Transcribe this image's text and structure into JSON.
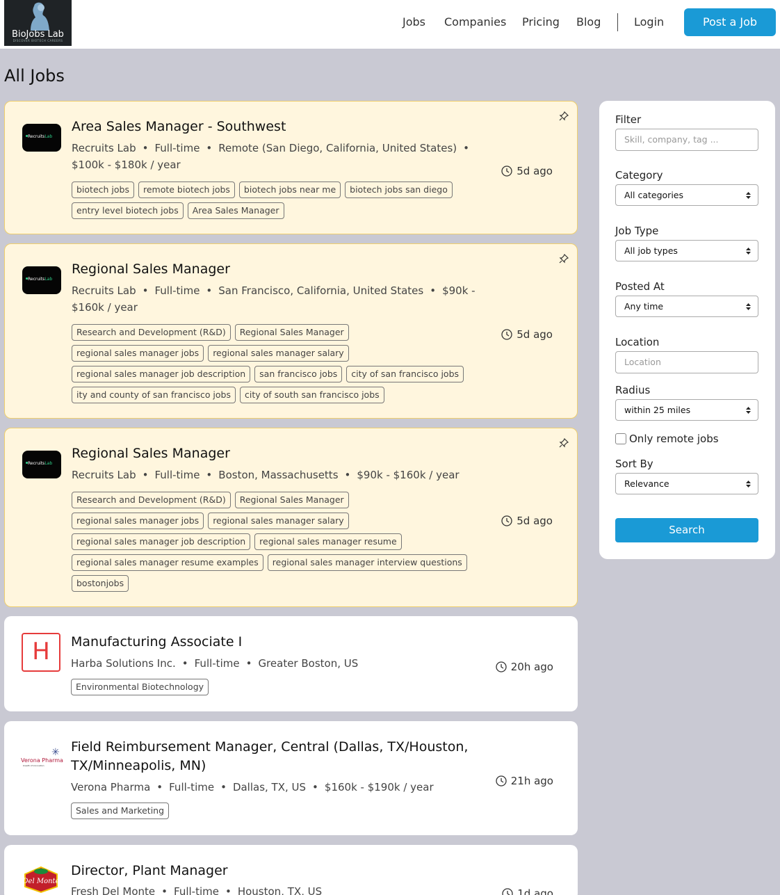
{
  "brand": {
    "name": "BioJobs Lab",
    "tagline": "DISCOVER BIOTECH CAREERS"
  },
  "nav": {
    "jobs": "Jobs",
    "companies": "Companies",
    "pricing": "Pricing",
    "blog": "Blog",
    "login": "Login",
    "post_job": "Post a Job"
  },
  "page_title": "All Jobs",
  "icons": {
    "pin": "pin-icon",
    "clock": "clock-icon",
    "caret": "select-caret-icon"
  },
  "colors": {
    "accent": "#1a9ad6",
    "featured_bg": "#fff6de",
    "featured_border": "#f0cf6c",
    "page_bg": "#c9c9d3"
  },
  "jobs": [
    {
      "title": "Area Sales Manager - Southwest",
      "company": "Recruits Lab",
      "meta_line1": [
        "Recruits Lab",
        "Full-time",
        "Remote (San Diego, California, United States)"
      ],
      "meta_line2": "$100k - $180k / year",
      "tags": [
        "biotech jobs",
        "remote biotech jobs",
        "biotech jobs near me",
        "biotech jobs san diego",
        "entry level biotech jobs",
        "Area Sales Manager"
      ],
      "posted": "5d ago",
      "featured": true
    },
    {
      "title": "Regional Sales Manager",
      "company": "Recruits Lab",
      "meta_line1": [
        "Recruits Lab",
        "Full-time",
        "San Francisco, California, United States",
        "$90k -"
      ],
      "meta_line2": "$160k / year",
      "tags": [
        "Research and Development (R&D)",
        "Regional Sales Manager",
        "regional sales manager jobs",
        "regional sales manager salary",
        "regional sales manager job description",
        "san francisco jobs",
        "city of san francisco jobs",
        "ity and county of san francisco jobs",
        "city of south san francisco jobs"
      ],
      "posted": "5d ago",
      "featured": true
    },
    {
      "title": "Regional Sales Manager",
      "company": "Recruits Lab",
      "meta_line1": [
        "Recruits Lab",
        "Full-time",
        "Boston, Massachusetts",
        "$90k - $160k / year"
      ],
      "meta_line2": "",
      "tags": [
        "Research and Development (R&D)",
        "Regional Sales Manager",
        "regional sales manager jobs",
        "regional sales manager salary",
        "regional sales manager job description",
        "regional sales manager resume",
        "regional sales manager resume examples",
        "regional sales manager interview questions",
        "bostonjobs"
      ],
      "posted": "5d ago",
      "featured": true
    },
    {
      "title": "Manufacturing Associate I",
      "company": "Harba Solutions Inc.",
      "logo_letter": "H",
      "meta_line1": [
        "Harba Solutions Inc.",
        "Full-time",
        "Greater Boston, US"
      ],
      "meta_line2": "",
      "tags": [
        "Environmental Biotechnology"
      ],
      "posted": "20h ago",
      "featured": false
    },
    {
      "title_line1": "Field Reimbursement Manager, Central (Dallas, TX/Houston,",
      "title_line2": "TX/Minneapolis, MN)",
      "company": "Verona Pharma",
      "logo_text": "Verona Pharma",
      "logo_sub": "breath of innovation",
      "meta_line1": [
        "Verona Pharma",
        "Full-time",
        "Dallas, TX, US",
        "$160k - $190k / year"
      ],
      "meta_line2": "",
      "tags": [
        "Sales and Marketing"
      ],
      "posted": "21h ago",
      "featured": false
    },
    {
      "title": "Director, Plant Manager",
      "company": "Fresh Del Monte",
      "logo_text": "Del Monte",
      "meta_line1": [
        "Fresh Del Monte",
        "Full-time",
        "Houston, TX, US"
      ],
      "meta_line2": "",
      "tags": [],
      "posted": "1d ago",
      "featured": false
    }
  ],
  "filters": {
    "filter_label": "Filter",
    "filter_placeholder": "Skill, company, tag ...",
    "category_label": "Category",
    "category_value": "All categories",
    "job_type_label": "Job Type",
    "job_type_value": "All job types",
    "posted_at_label": "Posted At",
    "posted_at_value": "Any time",
    "location_label": "Location",
    "location_placeholder": "Location",
    "radius_label": "Radius",
    "radius_value": "within 25 miles",
    "remote_label": "Only remote jobs",
    "sort_label": "Sort By",
    "sort_value": "Relevance",
    "search_label": "Search"
  }
}
